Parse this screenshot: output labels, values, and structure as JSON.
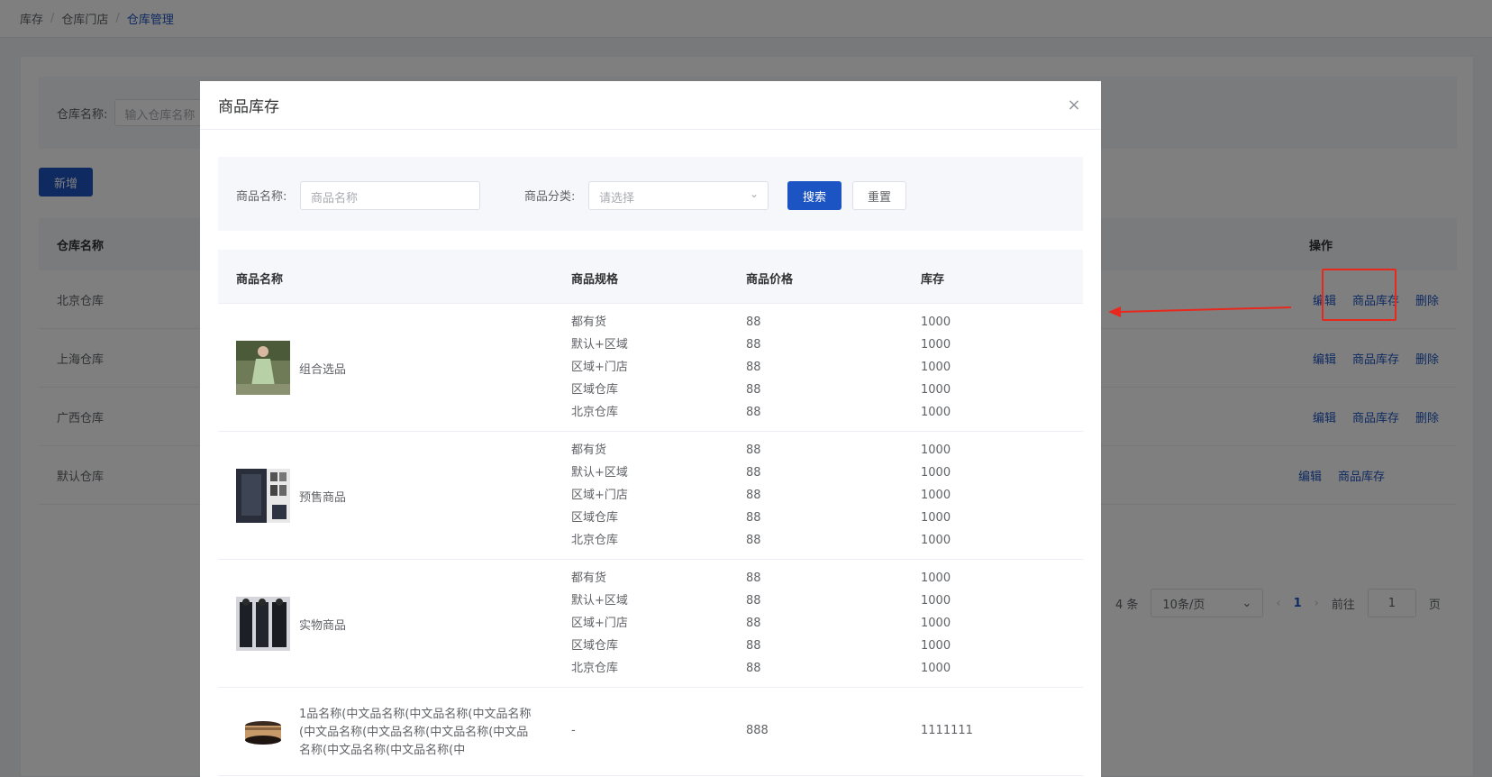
{
  "breadcrumb": [
    "库存",
    "仓库门店",
    "仓库管理"
  ],
  "page": {
    "search_label": "仓库名称:",
    "search_placeholder": "输入仓库名称",
    "add_button": "新增",
    "col_name": "仓库名称",
    "col_ops": "操作",
    "rows": [
      {
        "name": "北京仓库",
        "edit": "编辑",
        "stock": "商品库存",
        "delete": "删除"
      },
      {
        "name": "上海仓库",
        "edit": "编辑",
        "stock": "商品库存",
        "delete": "删除"
      },
      {
        "name": "广西仓库",
        "edit": "编辑",
        "stock": "商品库存",
        "delete": "删除"
      },
      {
        "name": "默认仓库",
        "edit": "编辑",
        "stock": "商品库存"
      }
    ],
    "pager": {
      "total_suffix": "4 条",
      "page_size": "10条/页",
      "current": "1",
      "goto_label": "前往",
      "goto_value": "1",
      "page_suffix": "页"
    }
  },
  "dialog": {
    "title": "商品库存",
    "close": "×",
    "name_label": "商品名称:",
    "name_placeholder": "商品名称",
    "category_label": "商品分类:",
    "category_placeholder": "请选择",
    "search_button": "搜索",
    "reset_button": "重置",
    "columns": {
      "name": "商品名称",
      "spec": "商品规格",
      "price": "商品价格",
      "stock": "库存"
    },
    "products": [
      {
        "name": "组合选品",
        "thumb": "dress-photo",
        "specs": [
          "都有货",
          "默认+区域",
          "区域+门店",
          "区域仓库",
          "北京仓库"
        ],
        "prices": [
          "88",
          "88",
          "88",
          "88",
          "88"
        ],
        "stocks": [
          "1000",
          "1000",
          "1000",
          "1000",
          "1000"
        ]
      },
      {
        "name": "预售商品",
        "thumb": "clothing-collage",
        "specs": [
          "都有货",
          "默认+区域",
          "区域+门店",
          "区域仓库",
          "北京仓库"
        ],
        "prices": [
          "88",
          "88",
          "88",
          "88",
          "88"
        ],
        "stocks": [
          "1000",
          "1000",
          "1000",
          "1000",
          "1000"
        ]
      },
      {
        "name": "实物商品",
        "thumb": "tracksuit-photo",
        "specs": [
          "都有货",
          "默认+区域",
          "区域+门店",
          "区域仓库",
          "北京仓库"
        ],
        "prices": [
          "88",
          "88",
          "88",
          "88",
          "88"
        ],
        "stocks": [
          "1000",
          "1000",
          "1000",
          "1000",
          "1000"
        ]
      },
      {
        "name_line1": "1品名称(中文品名称(中文品名称(中文品名称",
        "name_line2": "(中文品名称(中文品名称(中文品名称(中文品",
        "name_line3": "名称(中文品名称(中文品名称(中",
        "thumb": "cream-jar",
        "spec": "-",
        "price": "888",
        "stock": "1111111"
      }
    ]
  },
  "colors": {
    "primary": "#1d54c3",
    "highlight": "#e8281c"
  }
}
